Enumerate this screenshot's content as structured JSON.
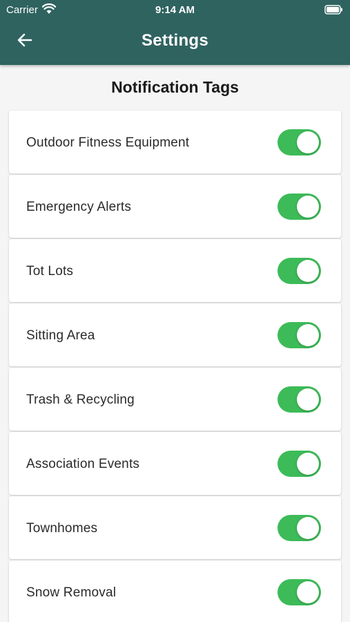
{
  "status_bar": {
    "carrier": "Carrier",
    "time": "9:14 AM",
    "wifi_icon": "wifi-icon",
    "battery_icon": "battery-icon"
  },
  "header": {
    "title": "Settings",
    "back_icon": "arrow-left-icon",
    "background_color": "#2f6360"
  },
  "section": {
    "title": "Notification Tags"
  },
  "toggle_color": "#3dbb58",
  "tags": [
    {
      "label": "Outdoor Fitness Equipment",
      "enabled": true
    },
    {
      "label": "Emergency Alerts",
      "enabled": true
    },
    {
      "label": "Tot Lots",
      "enabled": true
    },
    {
      "label": "Sitting Area",
      "enabled": true
    },
    {
      "label": "Trash & Recycling",
      "enabled": true
    },
    {
      "label": "Association Events",
      "enabled": true
    },
    {
      "label": "Townhomes",
      "enabled": true
    },
    {
      "label": "Snow Removal",
      "enabled": true
    }
  ]
}
